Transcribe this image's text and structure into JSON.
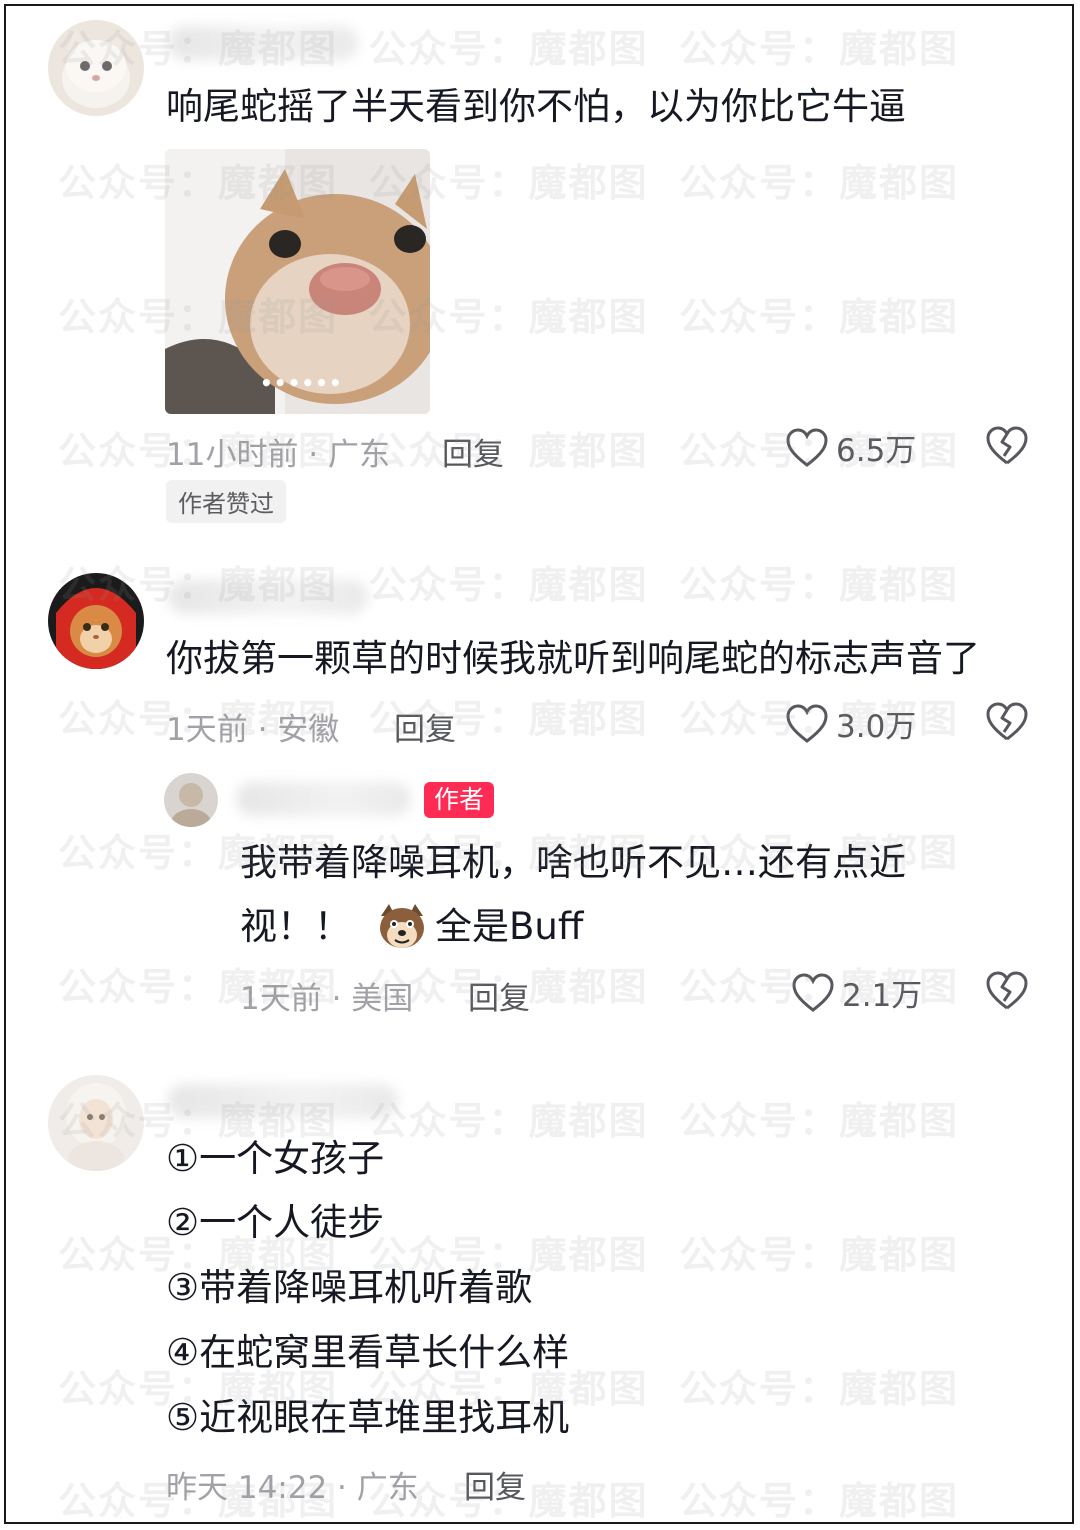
{
  "watermark_text": "公众号：魔都图",
  "comments": [
    {
      "text": "响尾蛇摇了半天看到你不怕，以为你比它牛逼",
      "sticker_caption": "••••••",
      "time_location": "11小时前 · 广东",
      "reply_label": "回复",
      "likes": "6.5万",
      "author_liked": "作者赞过"
    },
    {
      "text": "你拔第一颗草的时候我就听到响尾蛇的标志声音了",
      "time_location": "1天前 · 安徽",
      "reply_label": "回复",
      "likes": "3.0万"
    },
    {
      "author_badge": "作者",
      "text_line1": "我带着降噪耳机，啥也听不见…还有点近",
      "text_line2a": "视！！",
      "text_line2b": "全是Buff",
      "time_location": "1天前 · 美国",
      "reply_label": "回复",
      "likes": "2.1万"
    },
    {
      "items": [
        "①一个女孩子",
        "②一个人徒步",
        "③带着降噪耳机听着歌",
        "④在蛇窝里看草长什么样",
        "⑤近视眼在草堆里找耳机"
      ],
      "time_location": "昨天 14:22 · 广东",
      "reply_label": "回复"
    }
  ],
  "colors": {
    "accent_badge": "#fe2c55",
    "meta_gray": "#a1a2a7"
  }
}
